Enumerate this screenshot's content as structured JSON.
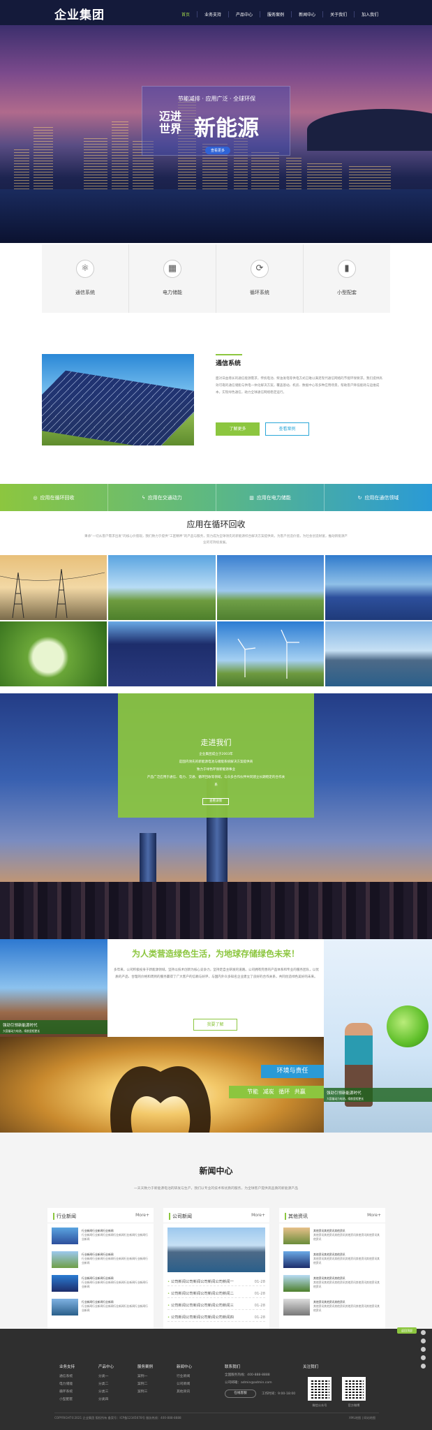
{
  "header": {
    "logo": "企业集团",
    "nav": [
      "首页",
      "业务支持",
      "产品中心",
      "服务案例",
      "新闻中心",
      "关于我们",
      "加入我们"
    ]
  },
  "hero": {
    "slogan_top": "节能减排 · 应用广泛 · 全球环保",
    "forward": "迈进世界",
    "new_energy": "新能源",
    "more": "查看更多"
  },
  "features": [
    {
      "icon": "atom-icon",
      "label": "通信系统"
    },
    {
      "icon": "grid-icon",
      "label": "电力储能"
    },
    {
      "icon": "cycle-icon",
      "label": "循环系统"
    },
    {
      "icon": "battery-icon",
      "label": "小型配套"
    }
  ],
  "comm": {
    "title": "通信系统",
    "desc": "面对日益增长的通信能源需求，传统电池、柴油发电等供电方式已难以满足现代通信网络的节能环保要求。我们提供高效可靠的通信储能与供电一体化解决方案，覆盖基站、机房、数据中心等多种应用场景，帮助客户降低能耗与运维成本，实现绿色通信，助力全球通信网络稳定运行。",
    "btn_more": "了解更多",
    "btn_case": "查看案例"
  },
  "band": [
    {
      "icon": "location-icon",
      "label": "应用在循环回收"
    },
    {
      "icon": "bolt-icon",
      "label": "应用在交通动力"
    },
    {
      "icon": "building-icon",
      "label": "应用在电力储能"
    },
    {
      "icon": "refresh-icon",
      "label": "应用在通信领域"
    }
  ],
  "apps": {
    "title": "应用在循环回收",
    "desc": "秉承“一切从客户需求出发”的核心价值观，我们致力于提供“工匠精神”的产品与服务，努力成为全球领先的新能源综合解决方案提供商，为客户创造价值，为社会创造财富，推动新能源产业的可持续发展。"
  },
  "about": {
    "title": "走进我们",
    "lines": [
      "企业集团成立于2003年",
      "是国内领先的新能源电池与储能系统解决方案提供商",
      "致力于绿色环保新能源事业",
      "产品广泛应用于通信、电力、交通、循环回收等领域，与众多合作伙伴共同建立长期稳定的合作关系"
    ],
    "more": "查看详情"
  },
  "life": {
    "title": "为人类营造绿色生活，为地球存储绿色未来！",
    "text": "多年来，公司积极投身于新能源领域，坚持以技术创新为核心竞争力，坚持走自主研发的道路。公司拥有完善的产品体系和专业的服务团队，以优质的产品、合理的价格和周到的服务赢得了广大客户的信赖与好评，与国内外众多知名企业建立了良好的合作关系，共同创造绿色美好的未来。",
    "btn": "我要了解",
    "cap1_title": "强劲引领新能源时代",
    "cap1_sub": "大容量动力电池，续航里程更长",
    "cap2_title": "强劲引领新能源时代",
    "cap2_sub": "大容量动力电池，续航里程更长",
    "env": "环境与责任",
    "env_sub": "节能 减炭 循环 共赢"
  },
  "news": {
    "title": "新闻中心",
    "desc": "一天天致力于新能源电池的研发与生产，我们以专业的技术和优质的服务，为全球客户提供高品质的新能源产品",
    "cols": [
      {
        "title": "行业新闻",
        "more": "More+",
        "items": [
          {
            "title": "行业新闻行业新闻行业新闻",
            "text": "行业新闻行业新闻行业新闻行业新闻行业新闻行业新闻行业新闻"
          },
          {
            "title": "行业新闻行业新闻行业新闻",
            "text": "行业新闻行业新闻行业新闻行业新闻行业新闻行业新闻行业新闻"
          },
          {
            "title": "行业新闻行业新闻行业新闻",
            "text": "行业新闻行业新闻行业新闻行业新闻行业新闻行业新闻行业新闻"
          },
          {
            "title": "行业新闻行业新闻行业新闻",
            "text": "行业新闻行业新闻行业新闻行业新闻行业新闻行业新闻行业新闻"
          }
        ]
      },
      {
        "title": "公司新闻",
        "more": "More+",
        "lines": [
          {
            "text": "公司新闻公司新闻公司新闻公司新闻一",
            "date": "01-28"
          },
          {
            "text": "公司新闻公司新闻公司新闻公司新闻二",
            "date": "01-28"
          },
          {
            "text": "公司新闻公司新闻公司新闻公司新闻三",
            "date": "01-28"
          },
          {
            "text": "公司新闻公司新闻公司新闻公司新闻四",
            "date": "01-28"
          }
        ]
      },
      {
        "title": "其他资讯",
        "more": "More+",
        "items": [
          {
            "title": "其他资讯其他资讯其他资讯",
            "text": "其他资讯其他资讯其他资讯其他资讯其他资讯其他资讯其他资讯"
          },
          {
            "title": "其他资讯其他资讯其他资讯",
            "text": "其他资讯其他资讯其他资讯其他资讯其他资讯其他资讯其他资讯"
          },
          {
            "title": "其他资讯其他资讯其他资讯",
            "text": "其他资讯其他资讯其他资讯其他资讯其他资讯其他资讯其他资讯"
          },
          {
            "title": "其他资讯其他资讯其他资讯",
            "text": "其他资讯其他资讯其他资讯其他资讯其他资讯其他资讯其他资讯"
          }
        ]
      }
    ]
  },
  "side": {
    "tag": "返回顶部"
  },
  "footer": {
    "cols": [
      {
        "head": "业务支持",
        "items": [
          "通信系统",
          "电力储能",
          "循环系统",
          "小型配套"
        ]
      },
      {
        "head": "产品中心",
        "items": [
          "分类一",
          "分类二",
          "分类三",
          "分类四"
        ]
      },
      {
        "head": "服务案例",
        "items": [
          "案例一",
          "案例二",
          "案例三"
        ]
      },
      {
        "head": "新闻中心",
        "items": [
          "行业新闻",
          "公司新闻",
          "其他资讯"
        ]
      }
    ],
    "contact_head": "联系我们",
    "contact_line1": "全国服务热线：400-888-8888",
    "contact_line2": "公司邮箱：admin@admin.com",
    "contact_btn": "在线客服",
    "contact_phone": "工作时间：9:00-18:00",
    "follow_head": "关注我们",
    "qr1": "微信公众号",
    "qr2": "官方微博",
    "copyright": "COPYRIGHT©2021 企业集团 版权所有 备案号：ICP备12345678号 服务热线：400-888-8888",
    "link": "XML地图 | 网站地图"
  }
}
